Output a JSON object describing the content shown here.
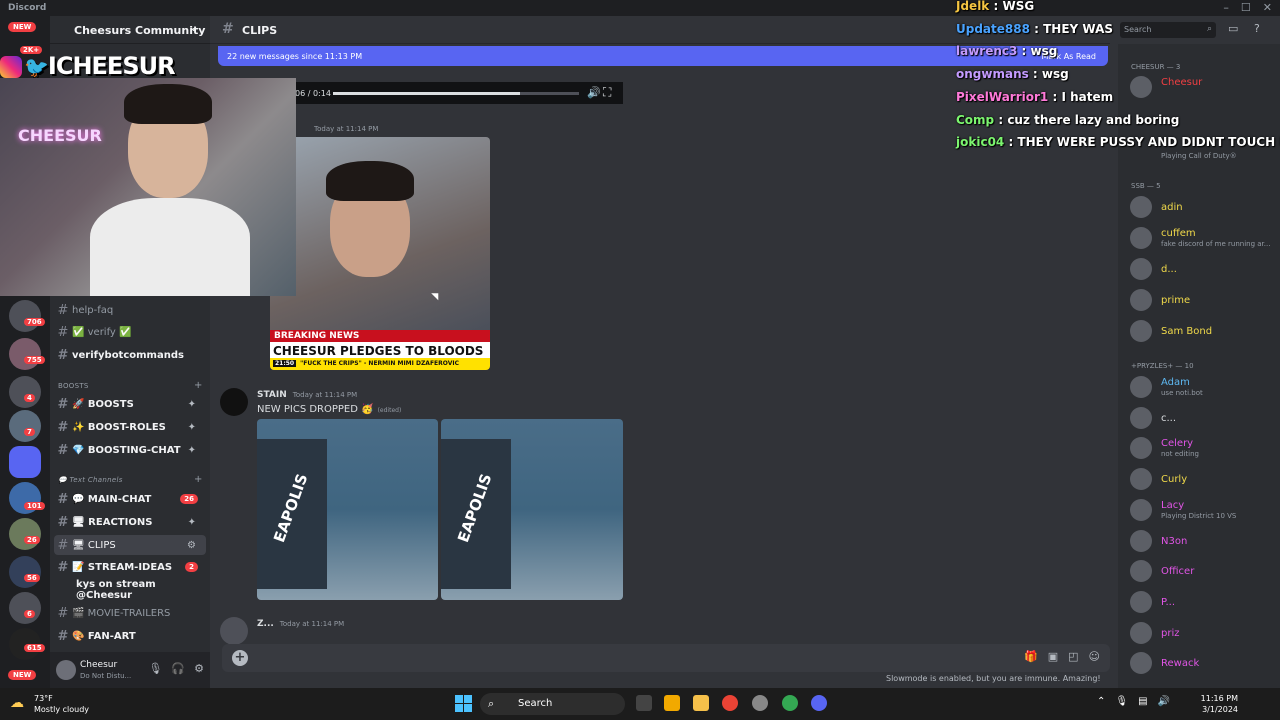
{
  "window": {
    "app_name": "Discord",
    "controls": [
      "–",
      "☐",
      "✕"
    ]
  },
  "server": {
    "name": "Cheesurs Community"
  },
  "rail": {
    "new_top": "NEW",
    "count_top": "2K+",
    "badges": [
      "706",
      "755",
      "4",
      "7",
      "101",
      "26",
      "56",
      "6",
      "615"
    ],
    "new_bottom": "NEW"
  },
  "channels": {
    "items_top": [
      {
        "label": "help-faq"
      },
      {
        "label": "✅ verify ✅"
      },
      {
        "label": "verifybotcommands"
      }
    ],
    "category_boosts": "BOOSTS",
    "boosts": [
      {
        "label": "🚀 BOOSTS"
      },
      {
        "label": "✨ BOOST-ROLES"
      },
      {
        "label": "💎 BOOSTING-CHAT"
      }
    ],
    "category_text": "💬 Text Channels",
    "text": [
      {
        "label": "💬 MAIN-CHAT",
        "badge": "26"
      },
      {
        "label": "🖥 REACTIONS"
      },
      {
        "label": "🖥 CLIPS"
      },
      {
        "label": "📝 STREAM-IDEAS",
        "badge": "2"
      },
      {
        "label": "kys on stream @Cheesur"
      },
      {
        "label": "🎬 MOVIE-TRAILERS"
      },
      {
        "label": "🎨 FAN-ART"
      }
    ]
  },
  "user": {
    "name": "Cheesur",
    "status": "Do Not Distu..."
  },
  "header": {
    "channel": "CLIPS"
  },
  "newbar": {
    "text": "22 new messages since 11:13 PM",
    "action": "Mark As Read"
  },
  "video": {
    "time": "06 / 0:14",
    "progress": 0.76
  },
  "messages": [
    {
      "author": "",
      "time": "Today at 11:14 PM"
    },
    {
      "author": "STAIN",
      "time": "Today at 11:14 PM",
      "text": "NEW PICS DROPPED 🥳",
      "edited": "(edited)"
    },
    {
      "author": "Z...",
      "time": "Today at 11:14 PM"
    }
  ],
  "news": {
    "breaking": "BREAKING NEWS",
    "headline": "CHEESUR PLEDGES TO BLOODS",
    "clock": "21:50",
    "ticker": "\"FUCK THE CRIPS\" - NERMIN MIMI DZAFEROVIC"
  },
  "photo_text": [
    "EAPOLIS",
    "EAPOLIS"
  ],
  "composer": {
    "slowmode": "Slowmode is enabled, but you are immune. Amazing!"
  },
  "chat_overlay": [
    {
      "user": "Jdelk",
      "msg": "WSG",
      "color": "#f5c542"
    },
    {
      "user": "Update888",
      "msg": "THEY WAS",
      "color": "#4aa3ff"
    },
    {
      "user": "lawrenc3",
      "msg": "wsg",
      "color": "#c49bff"
    },
    {
      "user": "ongwmans",
      "msg": "wsg",
      "color": "#c49bff"
    },
    {
      "user": "PixelWarrior1",
      "msg": "I hatem",
      "color": "#ff7ad9"
    },
    {
      "user": "Comp",
      "msg": "cuz there lazy and boring",
      "color": "#7cf56f"
    },
    {
      "user": "jokic04",
      "msg": "THEY WERE PUSSY AND DIDNT TOUCH IT",
      "color": "#7cf56f"
    }
  ],
  "search": {
    "placeholder": "Search"
  },
  "members": {
    "cat_cheesur": "CHEESUR — 3",
    "cheesur": [
      {
        "name": "Cheesur",
        "color": "#f23f43",
        "status": ""
      },
      {
        "name": "",
        "color": "#f2f3f5",
        "status": "Playing Call of Duty®"
      }
    ],
    "cat_ssb": "SSB — 5",
    "ssb": [
      {
        "name": "adin",
        "color": "#f0d94a",
        "status": ""
      },
      {
        "name": "cuffem",
        "color": "#f0d94a",
        "status": "fake discord of me running ar..."
      },
      {
        "name": "d...",
        "color": "#f0d94a",
        "status": ""
      },
      {
        "name": "prime",
        "color": "#f0d94a",
        "status": ""
      },
      {
        "name": "Sam Bond",
        "color": "#f0d94a",
        "status": ""
      }
    ],
    "cat_pryzles": "+Pryzles+ — 10",
    "pryzles": [
      {
        "name": "Adam",
        "color": "#5db7f0",
        "status": "use noti.bot"
      },
      {
        "name": "c...",
        "color": "#dbdee1",
        "status": ""
      },
      {
        "name": "Celery",
        "color": "#e155e6",
        "status": "not editing"
      },
      {
        "name": "Curly",
        "color": "#f0d94a",
        "status": ""
      },
      {
        "name": "Lacy",
        "color": "#e155e6",
        "status": "Playing District 10 VS"
      },
      {
        "name": "N3on",
        "color": "#e155e6",
        "status": ""
      },
      {
        "name": "Officer",
        "color": "#e155e6",
        "status": ""
      },
      {
        "name": "P...",
        "color": "#e155e6",
        "status": ""
      },
      {
        "name": "priz",
        "color": "#e155e6",
        "status": ""
      },
      {
        "name": "Rewack",
        "color": "#e155e6",
        "status": ""
      }
    ]
  },
  "brand": {
    "handle": "ICHEESUR",
    "neon": "CHEESUR"
  },
  "taskbar": {
    "temp": "73°F",
    "weather": "Mostly cloudy",
    "search": "Search",
    "time": "11:16 PM",
    "date": "3/1/2024"
  }
}
